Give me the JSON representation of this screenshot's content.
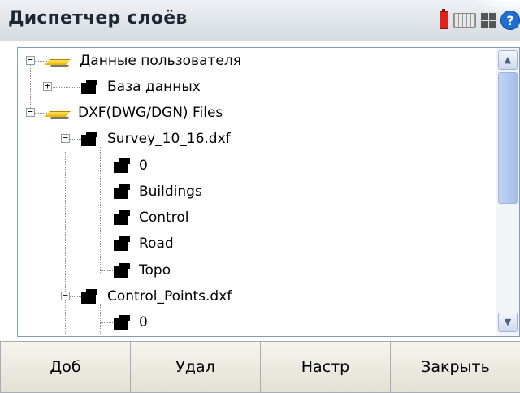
{
  "window": {
    "title": "Диспетчер слоёв"
  },
  "status_icons": [
    "battery-icon",
    "keyboard-icon",
    "windows-icon",
    "help-icon"
  ],
  "help_glyph": "?",
  "tree": {
    "user_data": "Данные пользователя",
    "database": "База данных",
    "dxf_files": "DXF(DWG/DGN) Files",
    "survey_file": "Survey_10_16.dxf",
    "survey_layers": [
      "0",
      "Buildings",
      "Control",
      "Road",
      "Topo"
    ],
    "control_file": "Control_Points.dxf",
    "control_layers": [
      "0"
    ]
  },
  "scrollbar": {
    "up": "▲",
    "down": "▼",
    "thumb_start": 0.0,
    "thumb_fraction": 0.55
  },
  "buttons": {
    "add": "Доб",
    "delete": "Удал",
    "settings": "Настр",
    "close": "Закрыть"
  }
}
